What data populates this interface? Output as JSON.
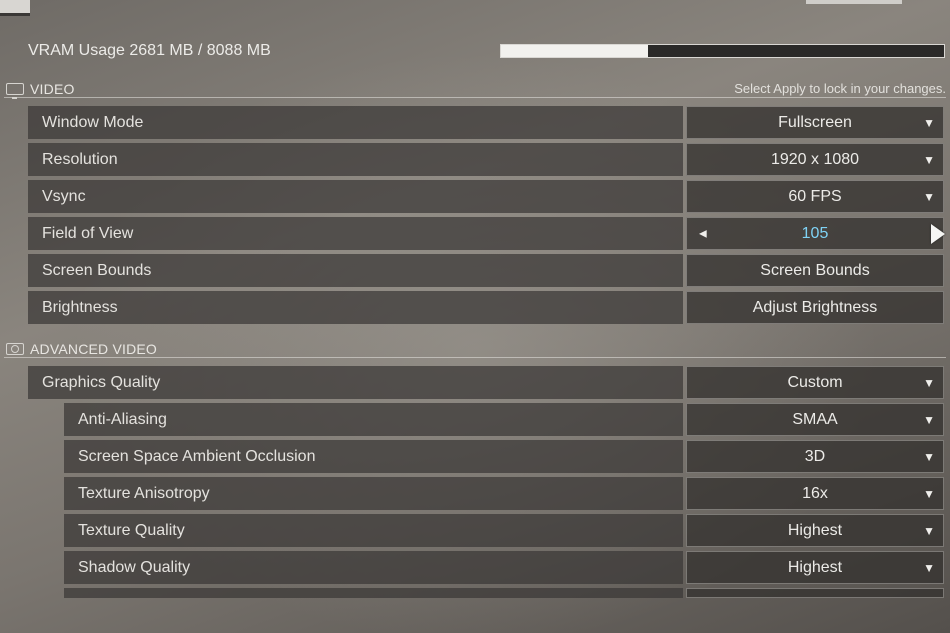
{
  "vram": {
    "label": "VRAM Usage 2681 MB / 8088 MB",
    "used_mb": 2681,
    "total_mb": 8088,
    "fill_fraction": 0.331
  },
  "video": {
    "title": "VIDEO",
    "hint": "Select Apply to lock in your changes.",
    "rows": [
      {
        "label": "Window Mode",
        "value": "Fullscreen",
        "icon": "chevron-down-icon"
      },
      {
        "label": "Resolution",
        "value": "1920 x 1080",
        "icon": "chevron-down-icon"
      },
      {
        "label": "Vsync",
        "value": "60 FPS",
        "icon": "chevron-down-icon"
      },
      {
        "label": "Field of View",
        "value": "105",
        "icon": "slider-arrows"
      },
      {
        "label": "Screen Bounds",
        "value": "Screen Bounds",
        "icon": ""
      },
      {
        "label": "Brightness",
        "value": "Adjust Brightness",
        "icon": ""
      }
    ]
  },
  "advanced": {
    "title": "ADVANCED VIDEO",
    "rows": [
      {
        "label": "Graphics Quality",
        "value": "Custom"
      },
      {
        "label": "Anti-Aliasing",
        "value": "SMAA"
      },
      {
        "label": "Screen Space Ambient Occlusion",
        "value": "3D"
      },
      {
        "label": "Texture Anisotropy",
        "value": "16x"
      },
      {
        "label": "Texture Quality",
        "value": "Highest"
      },
      {
        "label": "Shadow Quality",
        "value": "Highest"
      }
    ]
  },
  "colors": {
    "accent_value": "#7fd3f5",
    "row_bg": "#3a3836",
    "panel_bg": "#7a756f"
  }
}
